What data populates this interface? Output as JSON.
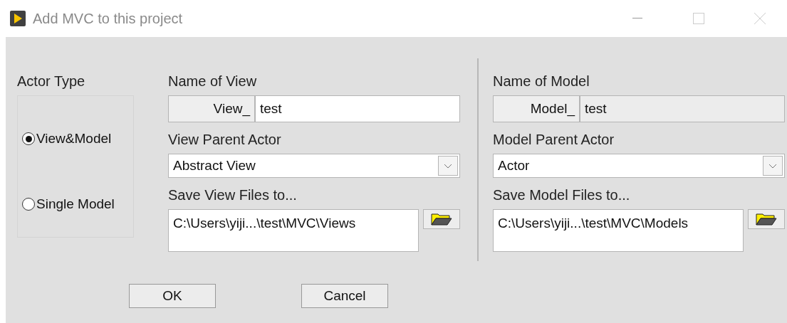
{
  "window": {
    "title": "Add MVC to this project"
  },
  "actor_type": {
    "label": "Actor Type",
    "options": [
      {
        "label": "View&Model",
        "selected": true
      },
      {
        "label": "Single Model",
        "selected": false
      }
    ]
  },
  "panels": [
    {
      "name_label": "Name of View",
      "prefix": "View_",
      "name_value": "test",
      "disabled": false,
      "parent_label": "View Parent Actor",
      "parent_value": "Abstract View",
      "path_label": "Save View Files to...",
      "path_value": "C:\\Users\\yiji...\\test\\MVC\\Views"
    },
    {
      "name_label": "Name of Model",
      "prefix": "Model_",
      "name_value": "test",
      "disabled": true,
      "parent_label": "Model Parent Actor",
      "parent_value": "Actor",
      "path_label": "Save Model Files to...",
      "path_value": "C:\\Users\\yiji...\\test\\MVC\\Models"
    }
  ],
  "buttons": [
    "OK",
    "Cancel"
  ]
}
